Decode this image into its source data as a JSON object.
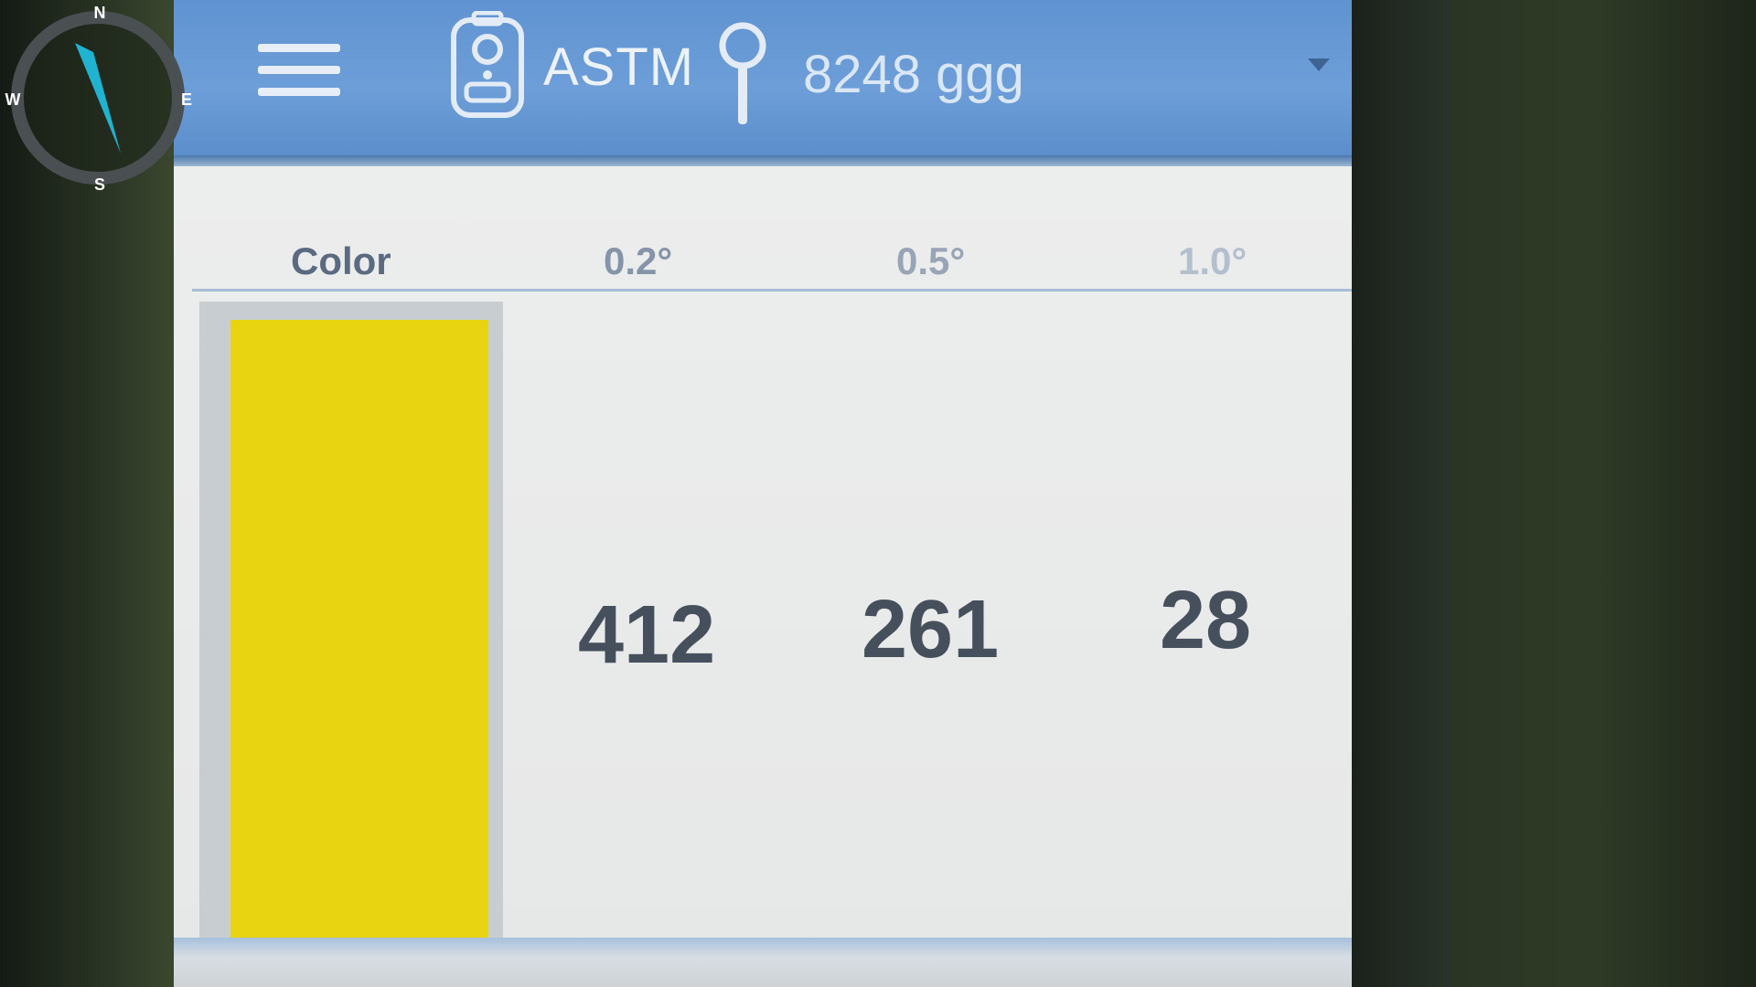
{
  "compass": {
    "north": "N",
    "south": "S",
    "east": "E",
    "west": "W",
    "needle_color": "#1fb3d1"
  },
  "app_bar": {
    "menu_icon": "hamburger-menu-icon",
    "device_icon": "handheld-device-icon",
    "device_label": "ASTM",
    "location_icon": "location-pin-icon",
    "location_label": "8248 ggg",
    "dropdown_icon": "dropdown-arrow-icon",
    "background_color": "#6d9ed8"
  },
  "table": {
    "headers": {
      "color": "Color",
      "angle_1": "0.2°",
      "angle_2": "0.5°",
      "angle_3": "1.0°"
    },
    "row": {
      "swatch_color": "#e8d410",
      "value_1": "412",
      "value_2": "261",
      "value_3": "28"
    }
  }
}
